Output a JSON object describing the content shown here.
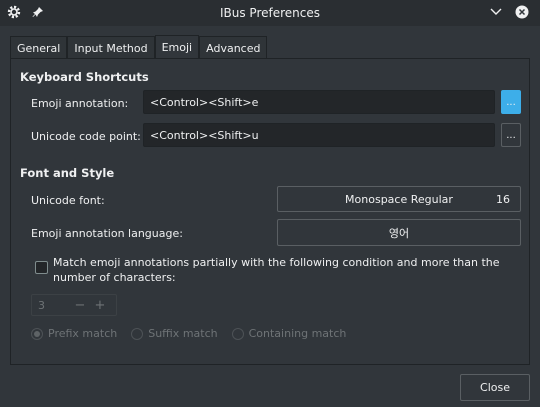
{
  "window": {
    "title": "IBus Preferences"
  },
  "tabs": [
    {
      "label": "General"
    },
    {
      "label": "Input Method"
    },
    {
      "label": "Emoji"
    },
    {
      "label": "Advanced"
    }
  ],
  "keyboard_shortcuts": {
    "title": "Keyboard Shortcuts",
    "emoji_annotation_label": "Emoji annotation:",
    "emoji_annotation_value": "<Control><Shift>e",
    "unicode_code_point_label": "Unicode code point:",
    "unicode_code_point_value": "<Control><Shift>u",
    "dots_label": "..."
  },
  "font_and_style": {
    "title": "Font and Style",
    "unicode_font_label": "Unicode font:",
    "unicode_font_name": "Monospace Regular",
    "unicode_font_size": "16",
    "emoji_language_label": "Emoji annotation language:",
    "emoji_language_value": "영어"
  },
  "match": {
    "checkbox_label": "Match emoji annotations partially with the following condition and more than the number of characters:",
    "spin_value": "3",
    "minus": "−",
    "plus": "+",
    "options": [
      "Prefix match",
      "Suffix match",
      "Containing match"
    ]
  },
  "footer": {
    "close_label": "Close"
  },
  "colors": {
    "accent": "#3daee9",
    "background": "#31363b",
    "titlebar": "#2a2e32"
  }
}
